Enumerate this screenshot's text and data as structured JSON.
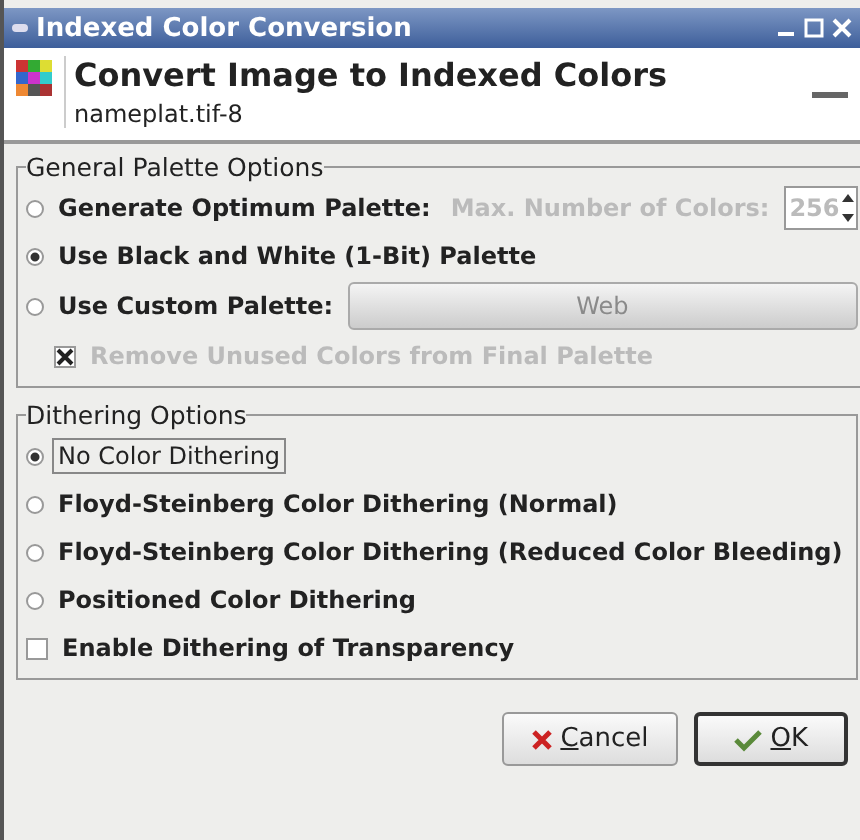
{
  "window": {
    "title": "Indexed Color Conversion"
  },
  "header": {
    "title": "Convert Image to Indexed Colors",
    "subtitle": "nameplat.tif-8"
  },
  "palette": {
    "title": "General Palette Options",
    "options": [
      {
        "kind": "optimum",
        "label": "Generate Optimum Palette:",
        "selected": false,
        "max_label": "Max. Number of Colors:",
        "max_value": "256",
        "disabled": true
      },
      {
        "kind": "plain",
        "label": "Use Black and White (1-Bit) Palette",
        "selected": true
      },
      {
        "kind": "custom",
        "label": "Use Custom Palette:",
        "selected": false,
        "palette_button": "Web",
        "disabled": true
      }
    ],
    "remove_unused": {
      "label": "Remove Unused Colors from Final Palette",
      "checked": true,
      "disabled": true
    }
  },
  "dithering": {
    "title": "Dithering Options",
    "options": [
      {
        "label": "No Color Dithering",
        "selected": true,
        "focused": true
      },
      {
        "label": "Floyd-Steinberg Color Dithering (Normal)",
        "selected": false,
        "focused": false
      },
      {
        "label": "Floyd-Steinberg Color Dithering (Reduced Color Bleeding)",
        "selected": false,
        "focused": false
      },
      {
        "label": "Positioned Color Dithering",
        "selected": false,
        "focused": false
      }
    ],
    "transparency": {
      "label": "Enable Dithering of Transparency",
      "checked": false
    }
  },
  "buttons": [
    {
      "kind": "cancel",
      "mnemonic": "C",
      "rest": "ancel",
      "default": false
    },
    {
      "kind": "ok",
      "mnemonic": "O",
      "rest": "K",
      "default": true
    }
  ]
}
